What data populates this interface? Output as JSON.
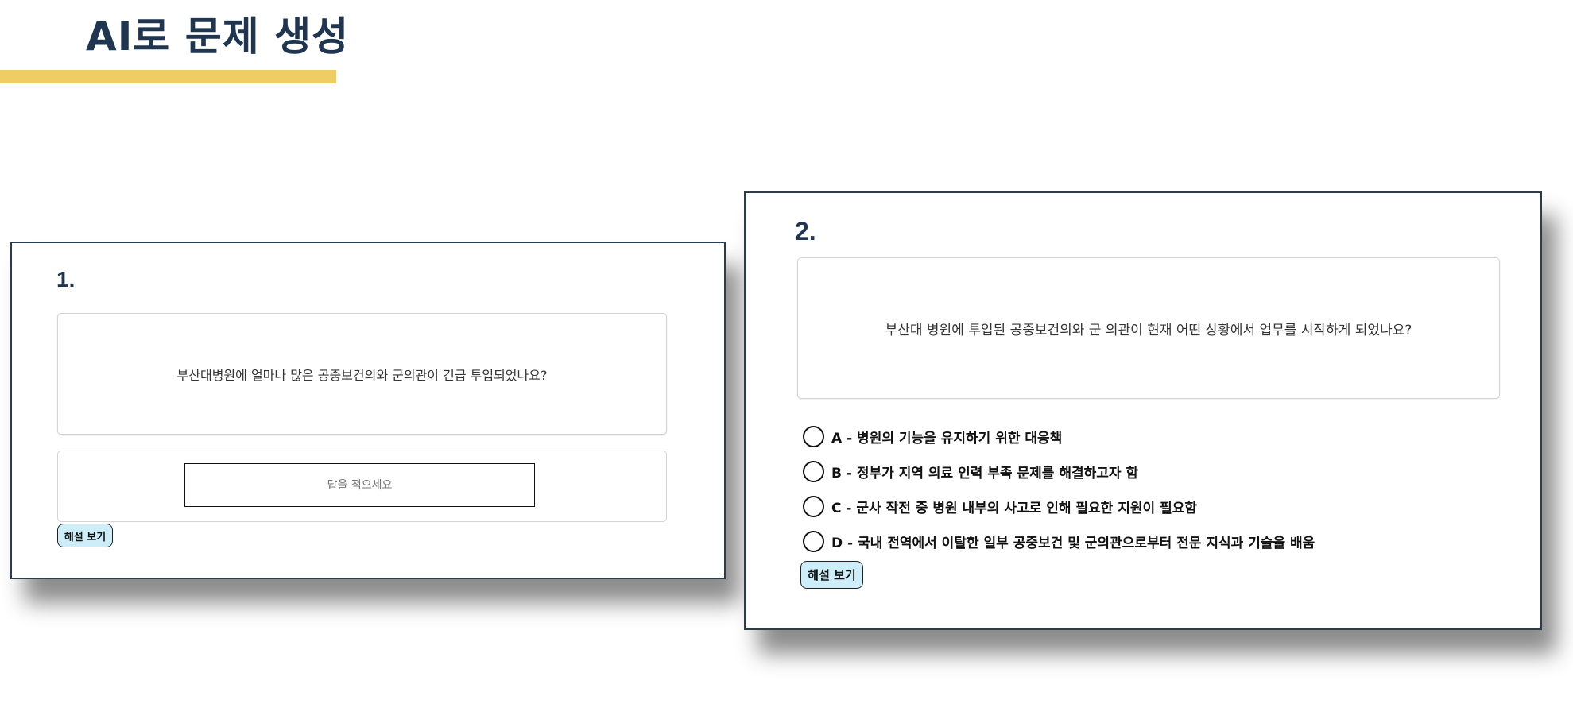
{
  "page": {
    "title": "AI로 문제 생성"
  },
  "questions": [
    {
      "number": "1.",
      "text": "부산대병원에 얼마나 많은 공중보건의와 군의관이 긴급 투입되었나요?",
      "answer_placeholder": "답을 적으세요",
      "explanation_button": "해설 보기"
    },
    {
      "number": "2.",
      "text": "부산대 병원에 투입된 공중보건의와 군 의관이 현재 어떤 상황에서 업무를 시작하게 되었나요?",
      "options": [
        "A - 병원의 기능을 유지하기 위한 대응책",
        "B - 정부가 지역 의료 인력 부족 문제를 해결하고자 함",
        "C - 군사 작전 중 병원 내부의 사고로 인해 필요한 지원이 필요함",
        "D - 국내 전역에서 이탈한 일부 공중보건 및 군의관으로부터 전문 지식과 기술을 배움"
      ],
      "explanation_button": "해설 보기"
    }
  ],
  "colors": {
    "title": "#1f3550",
    "underline": "#eecd64",
    "card_border": "#2a3c4f",
    "button_bg": "#cdeef8"
  }
}
